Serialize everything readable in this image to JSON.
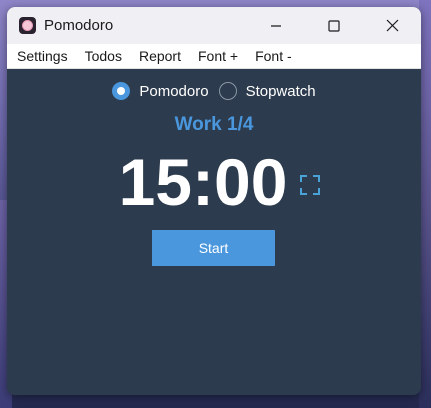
{
  "window": {
    "title": "Pomodoro"
  },
  "menu": {
    "items": [
      "Settings",
      "Todos",
      "Report",
      "Font +",
      "Font -"
    ]
  },
  "modes": {
    "options": [
      {
        "label": "Pomodoro",
        "selected": true
      },
      {
        "label": "Stopwatch",
        "selected": false
      }
    ]
  },
  "session": {
    "label": "Work 1/4"
  },
  "timer": {
    "display": "15:00"
  },
  "controls": {
    "start_label": "Start"
  },
  "colors": {
    "accent": "#4a97dd",
    "background": "#2c3b4d",
    "titlebar": "#f0eff4"
  },
  "icons": {
    "app": "tomato-app-icon",
    "minimize": "minimize-icon",
    "maximize": "maximize-icon",
    "close": "close-icon",
    "fullscreen": "fullscreen-icon"
  }
}
